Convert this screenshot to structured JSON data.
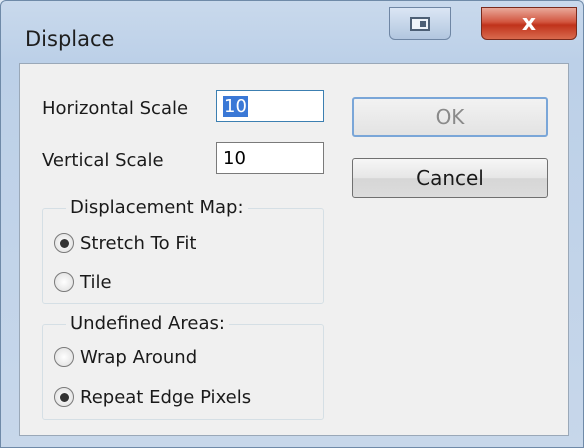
{
  "window": {
    "title": "Displace"
  },
  "titlebar": {
    "help_icon": "context-help-icon",
    "close_icon": "close-icon",
    "close_glyph": "x"
  },
  "fields": {
    "horizontal_scale": {
      "label": "Horizontal Scale",
      "value": "10"
    },
    "vertical_scale": {
      "label": "Vertical Scale",
      "value": "10"
    }
  },
  "buttons": {
    "ok": "OK",
    "cancel": "Cancel"
  },
  "displacement_map": {
    "title": "Displacement Map:",
    "options": [
      {
        "label": "Stretch To Fit",
        "checked": true
      },
      {
        "label": "Tile",
        "checked": false
      }
    ]
  },
  "undefined_areas": {
    "title": "Undefined Areas:",
    "options": [
      {
        "label": "Wrap Around",
        "checked": false
      },
      {
        "label": "Repeat Edge Pixels",
        "checked": true
      }
    ]
  }
}
